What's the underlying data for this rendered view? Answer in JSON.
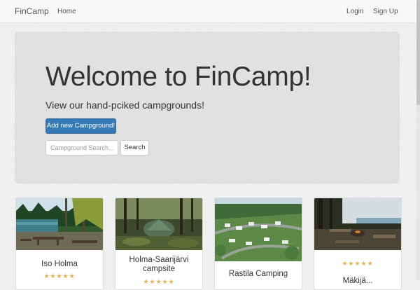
{
  "navbar": {
    "brand": "FinCamp",
    "home": "Home",
    "login": "Login",
    "signup": "Sign Up"
  },
  "hero": {
    "title": "Welcome to FinCamp!",
    "subtitle": "View our hand-pciked campgrounds!",
    "add_button": "Add new Campground!",
    "search_placeholder": "Campground Search...",
    "search_button": "Search"
  },
  "cards": [
    {
      "title": "Iso Holma",
      "rating": "★★★★★",
      "image": "lake-forest-with-picnic-tables"
    },
    {
      "title": "Holma-Saarijärvi campsite",
      "rating": "★★★★★",
      "image": "tent-in-forest"
    },
    {
      "title": "Rastila Camping",
      "rating": "",
      "image": "campground-with-caravans"
    },
    {
      "title": "Mäkijä...",
      "rating": "★★★★★",
      "image": "fire-pit-with-benches-by-lake"
    }
  ],
  "colors": {
    "primary": "#337ab7",
    "star": "#f0ad4e",
    "jumbotron": "#e3e3e3"
  }
}
